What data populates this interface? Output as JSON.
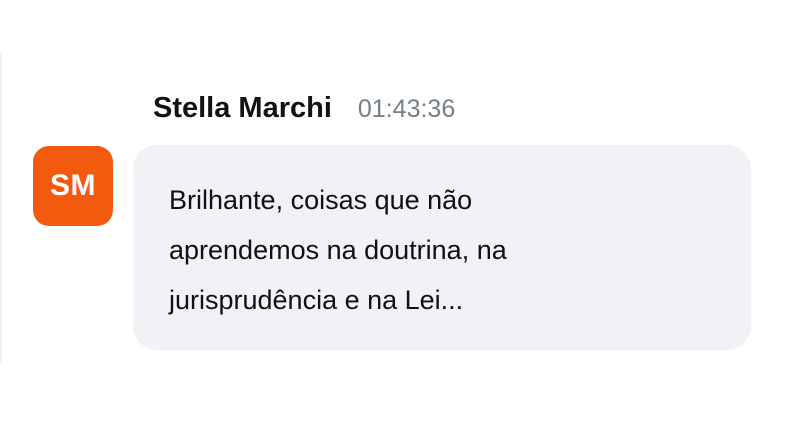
{
  "message": {
    "avatar": {
      "initials": "SM",
      "color": "#f35a0e"
    },
    "author": "Stella Marchi",
    "timestamp": "01:43:36",
    "text": "Brilhante, coisas que não aprendemos na doutrina, na jurisprudência e na Lei..."
  },
  "colors": {
    "bubble_background": "#f1f1f6",
    "timestamp": "#737f89",
    "text": "#111111"
  }
}
